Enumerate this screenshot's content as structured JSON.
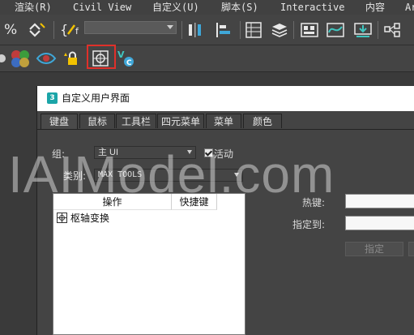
{
  "menubar": {
    "items": [
      "渲染(R)",
      "Civil View",
      "自定义(U)",
      "脚本(S)",
      "Interactive",
      "内容",
      "Ar"
    ]
  },
  "toolbar1": {
    "icons": [
      "percent-snap-icon",
      "spinner-snap-icon",
      "edit-named-selection-icon",
      "named-selection-set-dropdown",
      "mirror-icon",
      "align-icon",
      "toggle-scene-explorer-icon",
      "layer-manager-icon",
      "ribbon-icon",
      "curve-editor-icon",
      "schematic-view-icon",
      "material-editor-icon"
    ]
  },
  "toolbar2": {
    "icons": [
      "spheres-icon",
      "eye-icon",
      "lock-star-icon",
      "pivot-transform-icon",
      "maxscript-vc-icon"
    ],
    "highlight_color": "#e0302a"
  },
  "dialog": {
    "title": "自定义用户界面",
    "app_icon_letter": "3",
    "tabs": [
      "键盘",
      "鼠标",
      "工具栏",
      "四元菜单",
      "菜单",
      "颜色"
    ],
    "active_tab": "键盘",
    "group_label": "组:",
    "group_value": "主 UI",
    "active_checkbox_label": "活动",
    "category_label": "类别:",
    "category_value": "MAX TOOLS",
    "list": {
      "headers": [
        "操作",
        "快捷键"
      ],
      "rows": [
        {
          "action": "枢轴变换",
          "shortcut": ""
        }
      ]
    },
    "hotkey_label": "热键:",
    "assigned_to_label": "指定到:",
    "assign_button": "指定"
  },
  "watermark": "IAIModel.com"
}
